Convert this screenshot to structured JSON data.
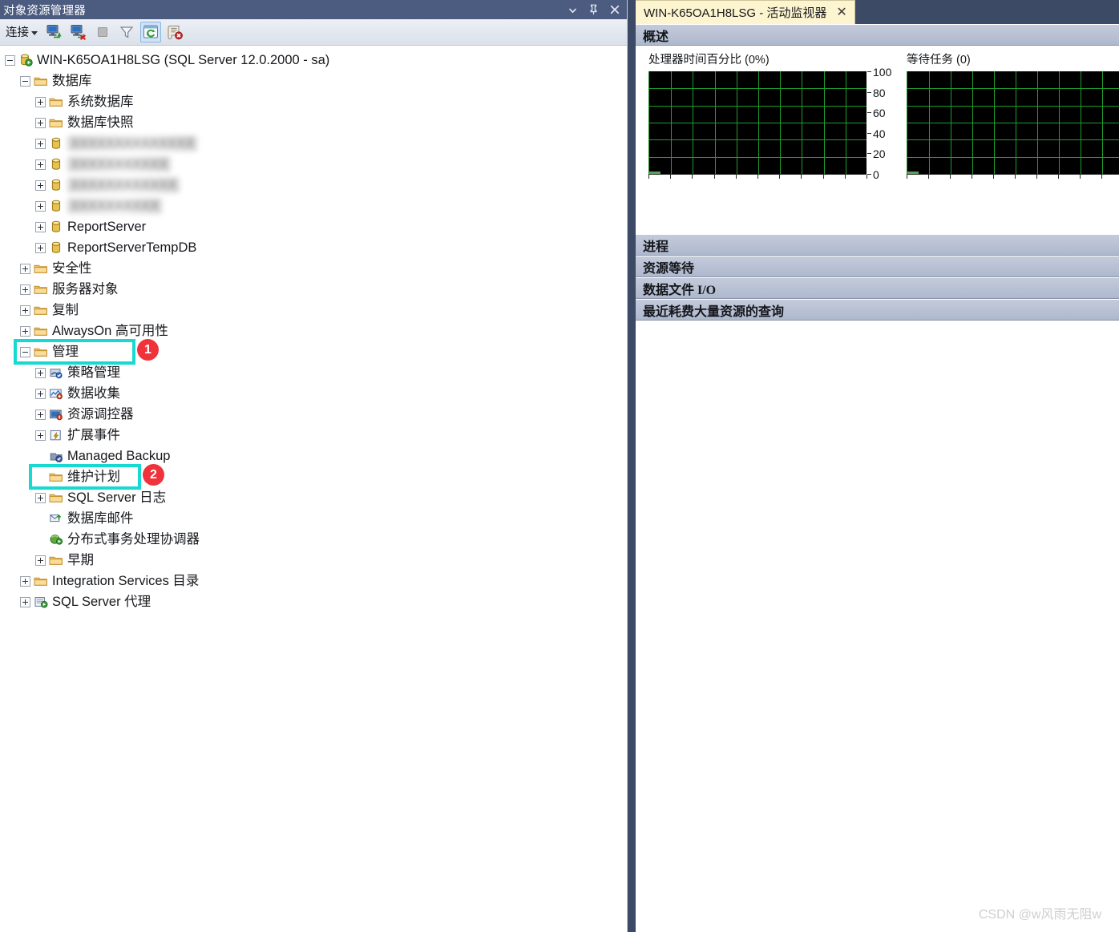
{
  "object_explorer": {
    "title": "对象资源管理器",
    "window_buttons": [
      {
        "name": "dropdown-icon",
        "glyph": "▾"
      },
      {
        "name": "pin-icon",
        "glyph": "📌"
      },
      {
        "name": "close-icon",
        "glyph": "✕"
      }
    ],
    "toolbar": {
      "connect_label": "连接",
      "buttons": [
        {
          "name": "connect-object-explorer-icon",
          "tooltip": "连接"
        },
        {
          "name": "disconnect-object-explorer-icon",
          "tooltip": "断开连接"
        },
        {
          "name": "stop-icon",
          "tooltip": "停止",
          "disabled": true
        },
        {
          "name": "filter-icon",
          "tooltip": "筛选器"
        },
        {
          "name": "refresh-icon",
          "tooltip": "刷新",
          "active": true
        },
        {
          "name": "script-error-icon",
          "tooltip": "报告"
        }
      ]
    },
    "tree": [
      {
        "id": "server",
        "label": "WIN-K65OA1H8LSG (SQL Server 12.0.2000 - sa)",
        "indent": 0,
        "state": "minus",
        "icon": "server-icon"
      },
      {
        "id": "databases",
        "label": "数据库",
        "indent": 1,
        "state": "minus",
        "icon": "folder-icon"
      },
      {
        "id": "system-databases",
        "label": "系统数据库",
        "indent": 2,
        "state": "plus",
        "icon": "folder-icon"
      },
      {
        "id": "database-snapshots",
        "label": "数据库快照",
        "indent": 2,
        "state": "plus",
        "icon": "folder-icon"
      },
      {
        "id": "db-redacted-1",
        "label": "XXXXXXXXXXXXXX",
        "indent": 2,
        "state": "plus",
        "icon": "database-icon",
        "redacted": true
      },
      {
        "id": "db-redacted-2",
        "label": "XXXXXXXXXXX",
        "indent": 2,
        "state": "plus",
        "icon": "database-icon",
        "redacted": true
      },
      {
        "id": "db-redacted-3",
        "label": "XXXXXXXXXXXX",
        "indent": 2,
        "state": "plus",
        "icon": "database-icon",
        "redacted": true
      },
      {
        "id": "db-redacted-4",
        "label": "XXXXXXXXXX",
        "indent": 2,
        "state": "plus",
        "icon": "database-icon",
        "redacted": true
      },
      {
        "id": "reportserver",
        "label": "ReportServer",
        "indent": 2,
        "state": "plus",
        "icon": "database-icon"
      },
      {
        "id": "reportservertempdb",
        "label": "ReportServerTempDB",
        "indent": 2,
        "state": "plus",
        "icon": "database-icon"
      },
      {
        "id": "security",
        "label": "安全性",
        "indent": 1,
        "state": "plus",
        "icon": "folder-icon"
      },
      {
        "id": "server-objects",
        "label": "服务器对象",
        "indent": 1,
        "state": "plus",
        "icon": "folder-icon"
      },
      {
        "id": "replication",
        "label": "复制",
        "indent": 1,
        "state": "plus",
        "icon": "folder-icon"
      },
      {
        "id": "alwayson",
        "label": "AlwaysOn 高可用性",
        "indent": 1,
        "state": "plus",
        "icon": "folder-icon"
      },
      {
        "id": "management",
        "label": "管理",
        "indent": 1,
        "state": "minus",
        "icon": "folder-icon",
        "highlight": 1
      },
      {
        "id": "policy-management",
        "label": "策略管理",
        "indent": 2,
        "state": "plus",
        "icon": "policy-icon"
      },
      {
        "id": "data-collection",
        "label": "数据收集",
        "indent": 2,
        "state": "plus",
        "icon": "data-collection-icon"
      },
      {
        "id": "resource-governor",
        "label": "资源调控器",
        "indent": 2,
        "state": "plus",
        "icon": "resource-governor-icon"
      },
      {
        "id": "extended-events",
        "label": "扩展事件",
        "indent": 2,
        "state": "plus",
        "icon": "extended-events-icon"
      },
      {
        "id": "managed-backup",
        "label": "Managed Backup",
        "indent": 2,
        "state": "none",
        "icon": "managed-backup-icon"
      },
      {
        "id": "maintenance-plans",
        "label": "维护计划",
        "indent": 2,
        "state": "none",
        "icon": "folder-icon",
        "highlight": 2
      },
      {
        "id": "sql-server-logs",
        "label": "SQL Server 日志",
        "indent": 2,
        "state": "plus",
        "icon": "folder-icon"
      },
      {
        "id": "database-mail",
        "label": "数据库邮件",
        "indent": 2,
        "state": "none",
        "icon": "database-mail-icon"
      },
      {
        "id": "dtc",
        "label": "分布式事务处理协调器",
        "indent": 2,
        "state": "none",
        "icon": "dtc-icon"
      },
      {
        "id": "legacy",
        "label": "早期",
        "indent": 2,
        "state": "plus",
        "icon": "folder-icon"
      },
      {
        "id": "integration-services",
        "label": "Integration Services 目录",
        "indent": 1,
        "state": "plus",
        "icon": "folder-icon"
      },
      {
        "id": "sql-server-agent",
        "label": "SQL Server 代理",
        "indent": 1,
        "state": "plus",
        "icon": "agent-icon"
      }
    ],
    "annotations": [
      {
        "number": "1",
        "target": "management"
      },
      {
        "number": "2",
        "target": "maintenance-plans"
      }
    ],
    "colors": {
      "highlight_border": "#16d9d1",
      "badge_bg": "#f0333b",
      "titlebar": "#4c5c80"
    }
  },
  "activity_monitor": {
    "tab_label": "WIN-K65OA1H8LSG - 活动监视器",
    "tab_close_glyph": "✕",
    "sections": [
      {
        "id": "overview",
        "label": "概述",
        "expanded": true
      },
      {
        "id": "processes",
        "label": "进程",
        "expanded": false
      },
      {
        "id": "resource-waits",
        "label": "资源等待",
        "expanded": false
      },
      {
        "id": "data-file-io",
        "label": "数据文件 I/O",
        "expanded": false
      },
      {
        "id": "recent-expensive-queries",
        "label": "最近耗费大量资源的查询",
        "expanded": false
      }
    ]
  },
  "chart_data": [
    {
      "type": "line",
      "id": "processor-time",
      "title": "处理器时间百分比 (0%)",
      "xlabel": "",
      "ylabel": "",
      "ylim": [
        0,
        100
      ],
      "yticks": [
        "100",
        "80",
        "60",
        "40",
        "20",
        "0"
      ],
      "grid": true,
      "series": [
        {
          "name": "处理器时间百分比",
          "values": [
            0,
            0,
            0,
            0,
            0,
            0,
            0,
            0,
            0,
            0
          ]
        }
      ],
      "plot_bg": "#000000",
      "grid_color": "#1f9e2b",
      "line_color": "#6fdc6f",
      "x_gridlines": 9,
      "y_gridlines": 5
    },
    {
      "type": "line",
      "id": "waiting-tasks",
      "title": "等待任务 (0)",
      "xlabel": "",
      "ylabel": "",
      "ylim": [
        0,
        100
      ],
      "yticks": [],
      "grid": true,
      "series": [
        {
          "name": "等待任务",
          "values": [
            0,
            0,
            0,
            0,
            0,
            0,
            0,
            0,
            0,
            0
          ]
        }
      ],
      "plot_bg": "#000000",
      "grid_color": "#1f9e2b",
      "line_color": "#6fdc6f",
      "x_gridlines": 9,
      "y_gridlines": 5
    }
  ],
  "watermark": "CSDN @w风雨无阻w"
}
